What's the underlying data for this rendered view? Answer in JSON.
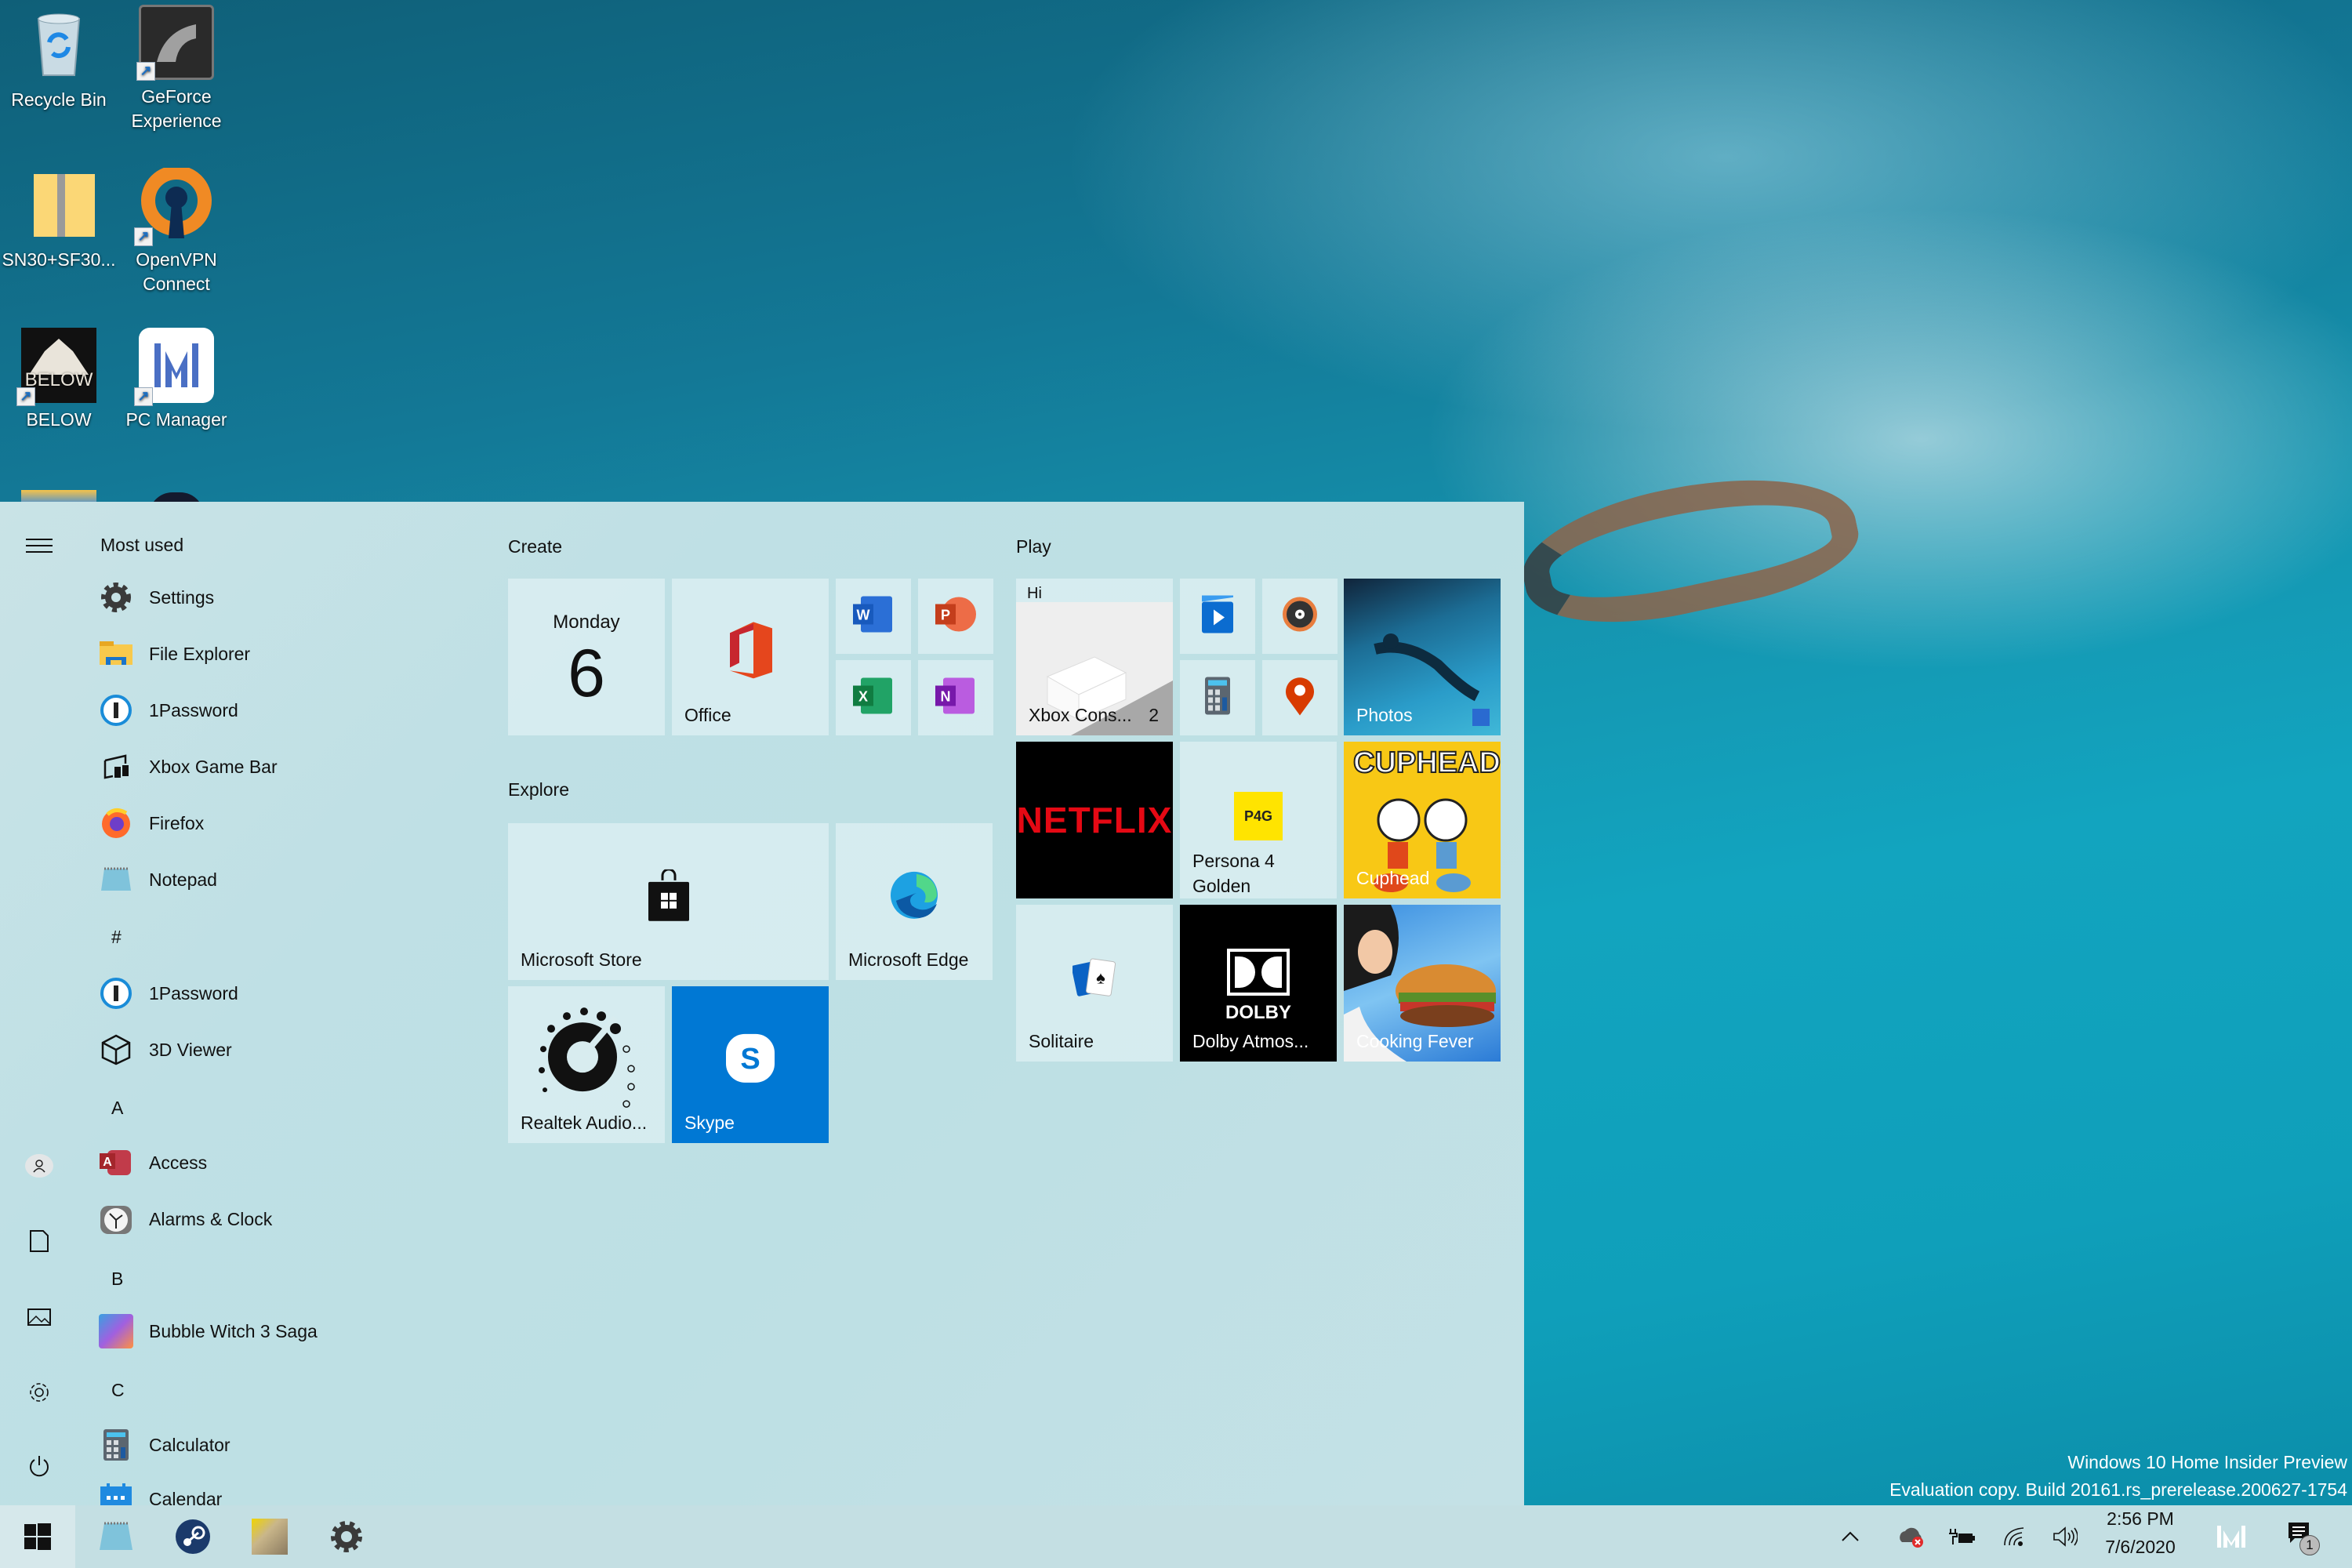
{
  "desktop": {
    "icons": [
      {
        "label": "Recycle Bin",
        "icon": "recycle-bin-icon"
      },
      {
        "label": "GeForce Experience",
        "icon": "geforce-icon"
      },
      {
        "label": "SN30+SF30...",
        "icon": "zip-folder-icon"
      },
      {
        "label": "OpenVPN Connect",
        "icon": "openvpn-icon"
      },
      {
        "label": "BELOW",
        "icon": "below-game-icon"
      },
      {
        "label": "PC Manager",
        "icon": "pc-manager-icon"
      }
    ],
    "below_logo_text": "BELOW",
    "watermark": {
      "line1": "Windows 10 Home Insider Preview",
      "line2": "Evaluation copy. Build 20161.rs_prerelease.200627-1754"
    }
  },
  "start_menu": {
    "rail": {
      "menu": "hamburger-icon",
      "items": [
        "user-account",
        "documents",
        "pictures",
        "settings",
        "power"
      ]
    },
    "most_used_header": "Most used",
    "most_used": [
      {
        "label": "Settings",
        "icon": "settings-gear-icon"
      },
      {
        "label": "File Explorer",
        "icon": "file-explorer-icon"
      },
      {
        "label": "1Password",
        "icon": "1password-icon"
      },
      {
        "label": "Xbox Game Bar",
        "icon": "xbox-game-bar-icon"
      },
      {
        "label": "Firefox",
        "icon": "firefox-icon"
      },
      {
        "label": "Notepad",
        "icon": "notepad-icon"
      }
    ],
    "sections": [
      {
        "letter": "#",
        "apps": [
          {
            "label": "1Password"
          },
          {
            "label": "3D Viewer"
          }
        ]
      },
      {
        "letter": "A",
        "apps": [
          {
            "label": "Access"
          },
          {
            "label": "Alarms & Clock"
          }
        ]
      },
      {
        "letter": "B",
        "apps": [
          {
            "label": "Bubble Witch 3 Saga"
          }
        ]
      },
      {
        "letter": "C",
        "apps": [
          {
            "label": "Calculator"
          },
          {
            "label": "Calendar"
          }
        ]
      }
    ],
    "groups": {
      "create": {
        "title": "Create",
        "calendar": {
          "day": "Monday",
          "date": "6"
        },
        "office": {
          "label": "Office"
        },
        "small": [
          "Word",
          "PowerPoint",
          "Excel",
          "OneNote"
        ],
        "small_letters": [
          "W",
          "P",
          "X",
          "N"
        ]
      },
      "explore": {
        "title": "Explore",
        "store": {
          "label": "Microsoft Store"
        },
        "edge": {
          "label": "Microsoft Edge"
        },
        "realtek": {
          "label": "Realtek Audio..."
        },
        "skype": {
          "label": "Skype",
          "letter": "S"
        }
      },
      "play": {
        "title": "Play",
        "xbox": {
          "greeting": "Hi",
          "label": "Xbox Cons...",
          "badge": "2"
        },
        "small": [
          "Movies & TV",
          "Groove Music",
          "Calculator",
          "Maps"
        ],
        "photos": {
          "label": "Photos"
        },
        "netflix": {
          "logo": "NETFLIX"
        },
        "persona": {
          "label": "Persona 4 Golden",
          "logo": "P4G"
        },
        "cuphead": {
          "label": "Cuphead",
          "logo": "CUPHEAD"
        },
        "solitaire": {
          "label": "Solitaire"
        },
        "dolby": {
          "label": "Dolby Atmos...",
          "logo": "DOLBY"
        },
        "cooking": {
          "label": "Cooking Fever"
        }
      }
    }
  },
  "taskbar": {
    "pinned": [
      "Start",
      "Notepad",
      "Steam",
      "Persona 4 Golden",
      "Settings"
    ],
    "tray": {
      "time": "2:56 PM",
      "date": "7/6/2020",
      "notification_count": "1"
    }
  },
  "colors": {
    "skype_blue": "#0078d4",
    "netflix_red": "#e50914",
    "cuphead_yellow": "#f8c815",
    "start_bg": "#c2e0e4"
  }
}
